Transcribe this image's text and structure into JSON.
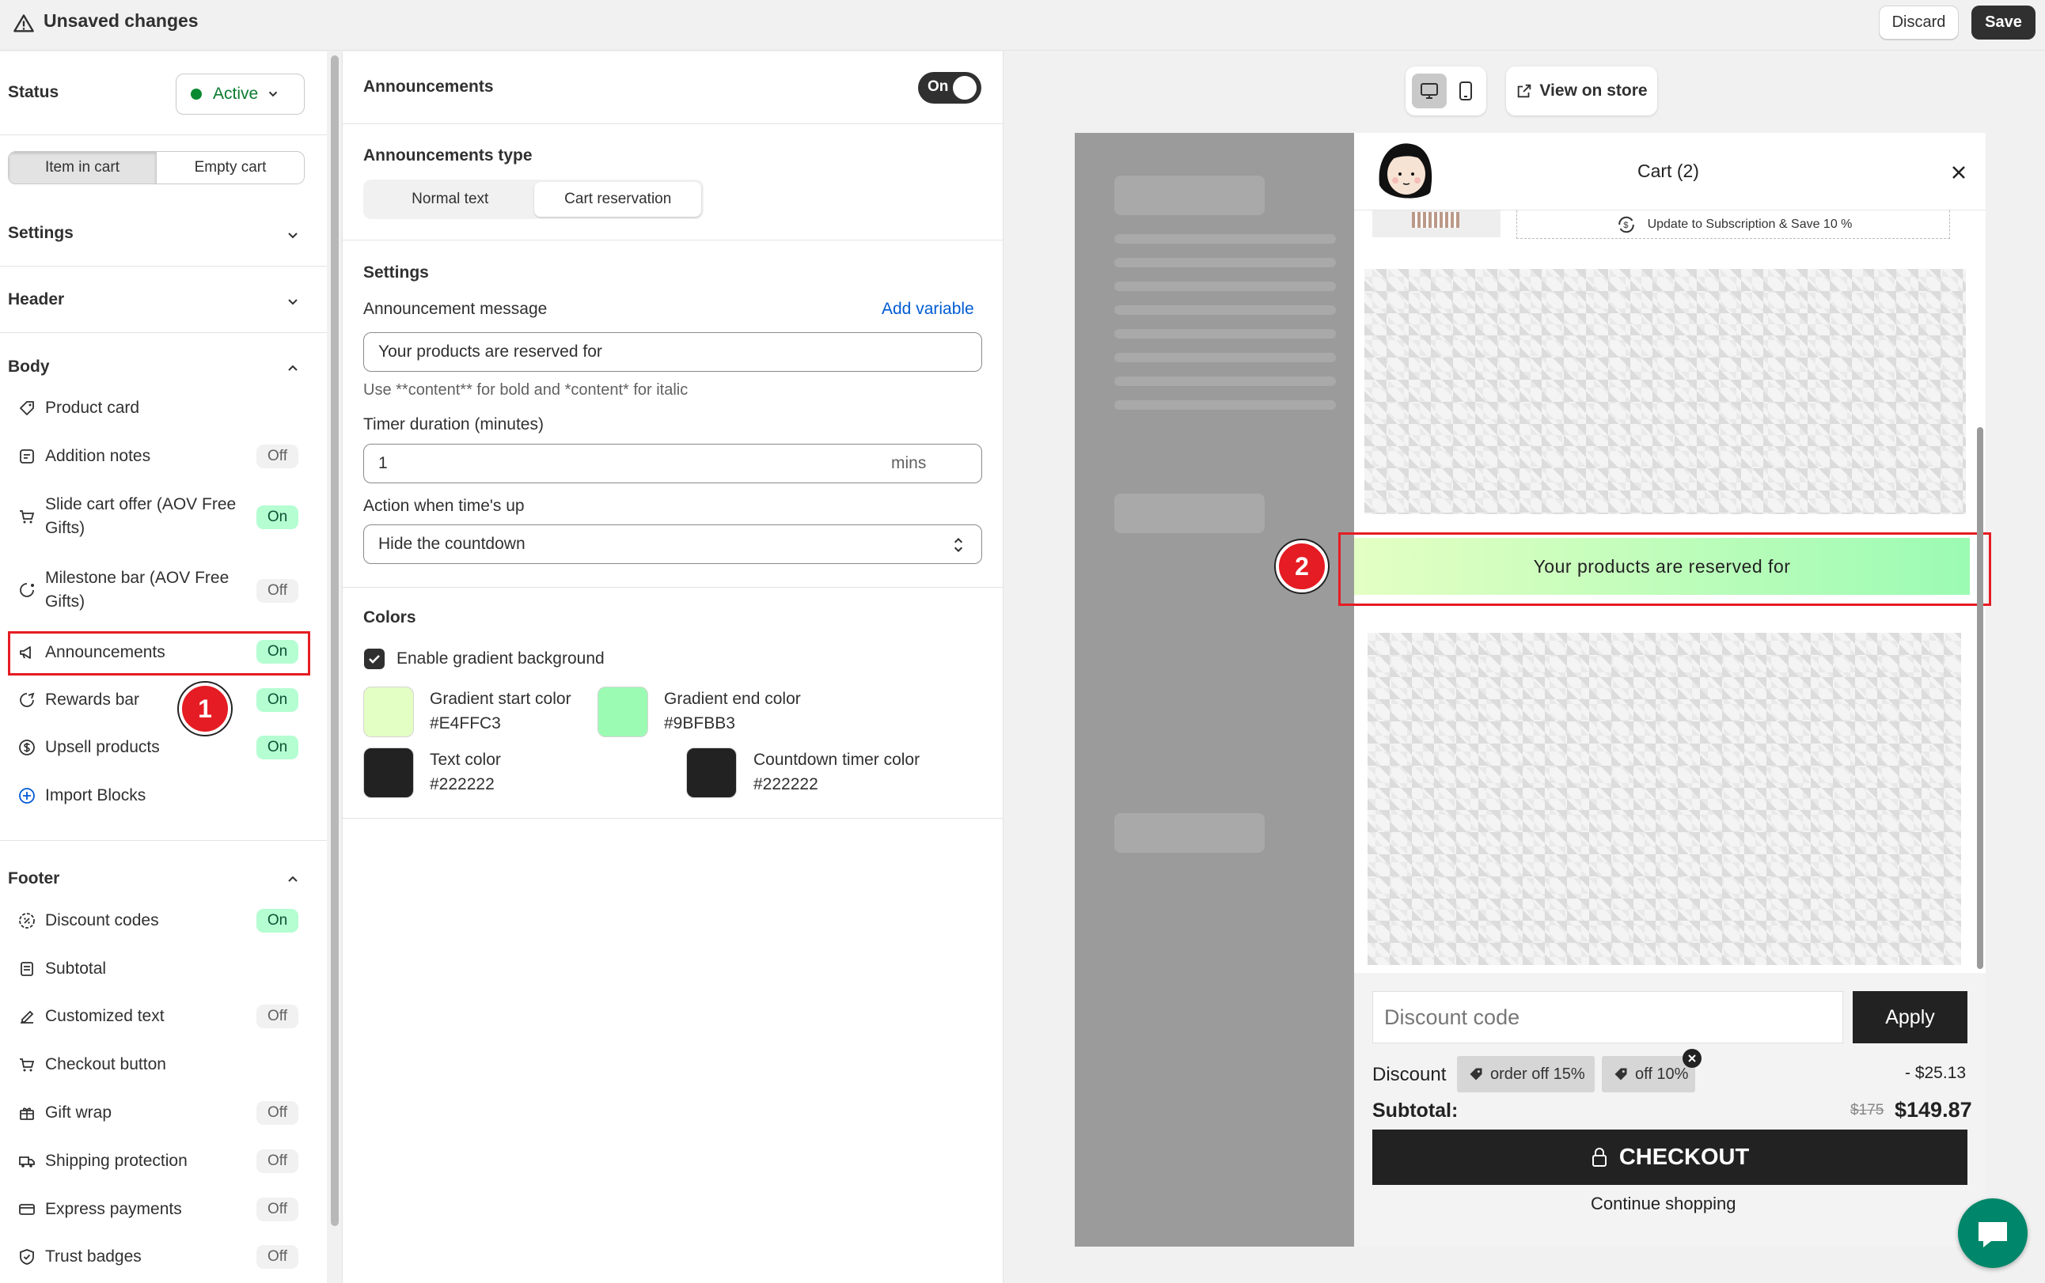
{
  "topbar": {
    "title": "Unsaved changes",
    "discard": "Discard",
    "save": "Save"
  },
  "left": {
    "status_label": "Status",
    "status_value": "Active",
    "tabs": [
      "Item in cart",
      "Empty cart"
    ],
    "settings": "Settings",
    "header": "Header",
    "body": "Body",
    "body_items": [
      {
        "label": "Product card",
        "badge": ""
      },
      {
        "label": "Addition notes",
        "badge": "Off"
      },
      {
        "label": "Slide cart offer (AOV Free",
        "label2": "Gifts)",
        "badge": "On"
      },
      {
        "label": "Milestone bar (AOV Free",
        "label2": "Gifts)",
        "badge": "Off"
      },
      {
        "label": "Announcements",
        "badge": "On"
      },
      {
        "label": "Rewards bar",
        "badge": "On"
      },
      {
        "label": "Upsell products",
        "badge": "On"
      }
    ],
    "import_blocks": "Import Blocks",
    "footer": "Footer",
    "footer_items": [
      {
        "label": "Discount codes",
        "badge": "On"
      },
      {
        "label": "Subtotal",
        "badge": ""
      },
      {
        "label": "Customized text",
        "badge": "Off"
      },
      {
        "label": "Checkout button",
        "badge": ""
      },
      {
        "label": "Gift wrap",
        "badge": "Off"
      },
      {
        "label": "Shipping protection",
        "badge": "Off"
      },
      {
        "label": "Express payments",
        "badge": "Off"
      },
      {
        "label": "Trust badges",
        "badge": "Off"
      }
    ]
  },
  "annotations": {
    "one": "1",
    "two": "2"
  },
  "mid": {
    "announcements": "Announcements",
    "toggle": "On",
    "type_label": "Announcements type",
    "type_options": [
      "Normal text",
      "Cart reservation"
    ],
    "settings": "Settings",
    "message_label": "Announcement message",
    "add_variable": "Add variable",
    "message_value": "Your products are reserved for",
    "message_help": "Use **content** for bold and *content* for italic",
    "timer_label": "Timer duration (minutes)",
    "timer_value": "1",
    "timer_unit": "mins",
    "action_label": "Action when time's up",
    "action_value": "Hide the countdown",
    "colors": "Colors",
    "gradient_check": "Enable gradient background",
    "grad_start_label": "Gradient start color",
    "grad_start": "#E4FFC3",
    "grad_end_label": "Gradient end color",
    "grad_end": "#9BFBB3",
    "text_color_label": "Text color",
    "text_color": "#222222",
    "timer_color_label": "Countdown timer color",
    "timer_color": "#222222"
  },
  "preview": {
    "view_on_store": "View on store",
    "cart_title": "Cart (2)",
    "subscription": "Update to Subscription & Save 10 %",
    "announcement": "Your products are reserved for",
    "discount_placeholder": "Discount code",
    "apply": "Apply",
    "discount_label": "Discount",
    "tags": [
      "order off 15%",
      "off 10%"
    ],
    "discount_amount": "- $25.13",
    "subtotal_label": "Subtotal:",
    "old_price": "$175",
    "new_price": "$149.87",
    "checkout": "CHECKOUT",
    "continue": "Continue shopping"
  }
}
